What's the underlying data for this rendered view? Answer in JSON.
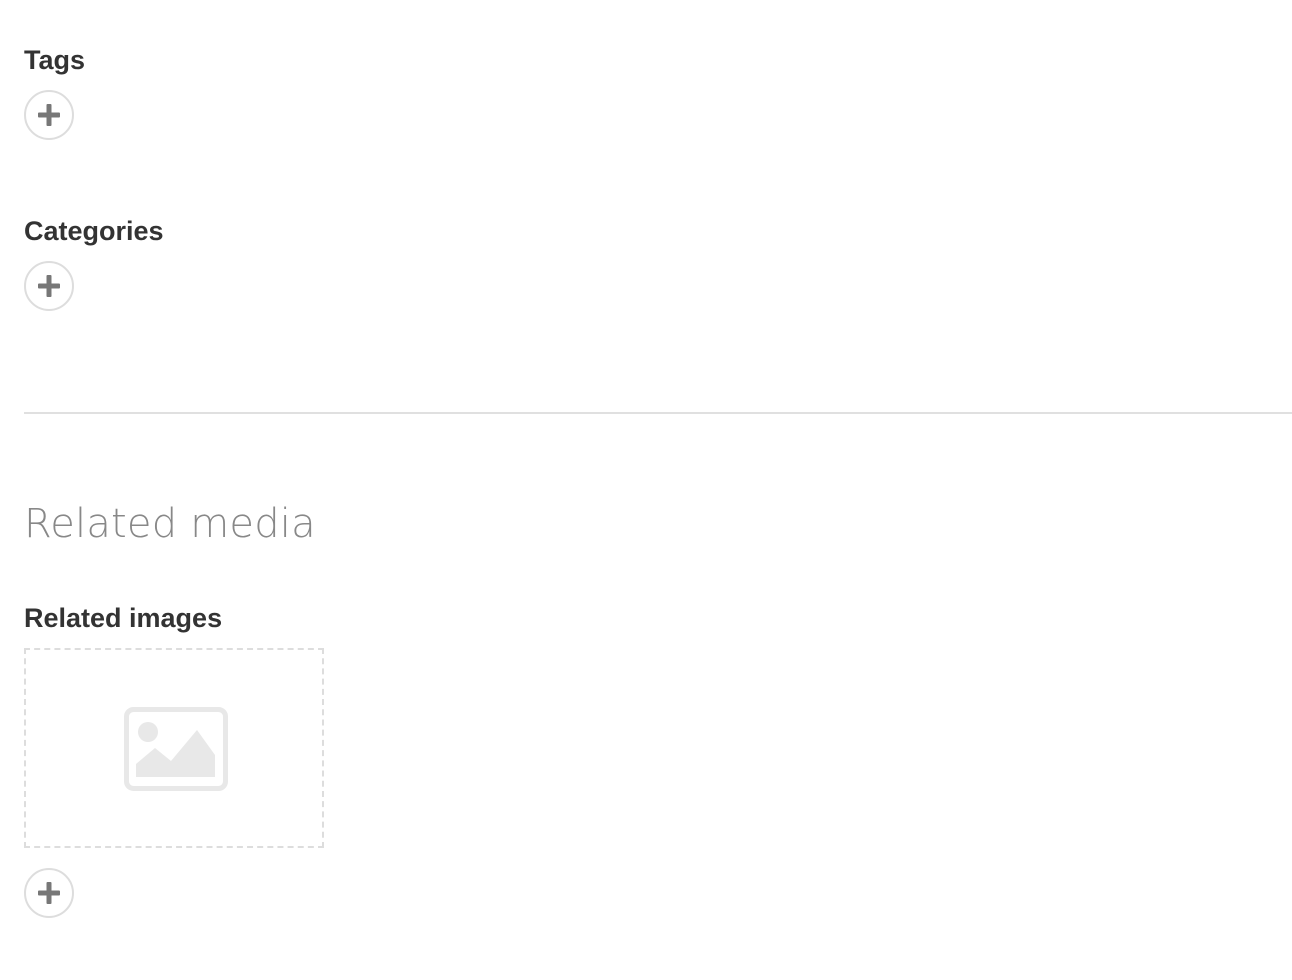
{
  "tags": {
    "label": "Tags",
    "add_icon": "plus-icon"
  },
  "categories": {
    "label": "Categories",
    "add_icon": "plus-icon"
  },
  "related_media": {
    "heading": "Related media",
    "related_images": {
      "label": "Related images",
      "placeholder_icon": "image-placeholder-icon",
      "add_icon": "plus-icon"
    }
  },
  "colors": {
    "label_text": "#333333",
    "heading_text": "#888888",
    "border": "#dddddd",
    "icon": "#777777",
    "placeholder_icon": "#e8e8e8"
  }
}
